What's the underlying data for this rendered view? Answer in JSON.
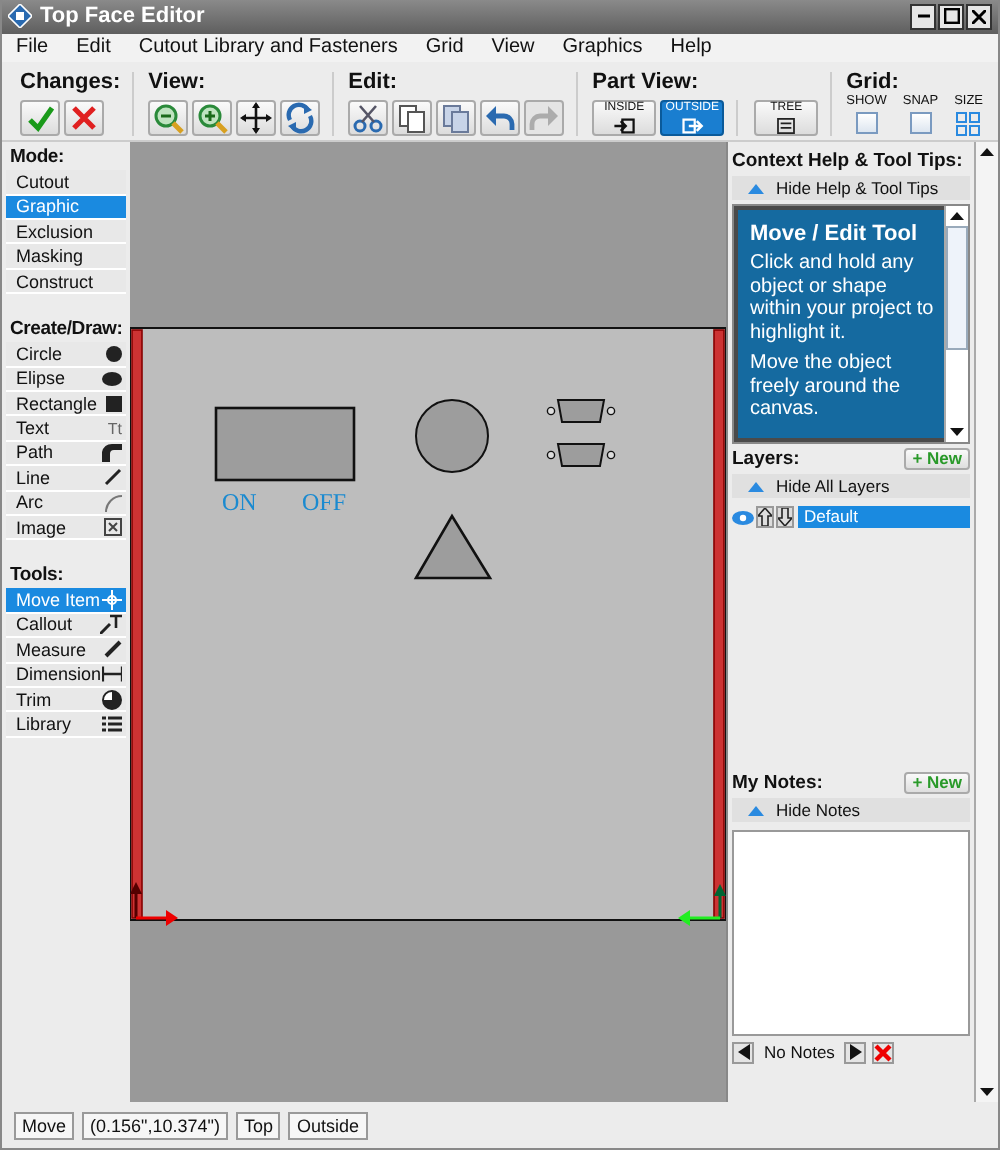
{
  "window": {
    "title": "Top Face Editor"
  },
  "menu": [
    "File",
    "Edit",
    "Cutout Library and Fasteners",
    "Grid",
    "View",
    "Graphics",
    "Help"
  ],
  "toolbar": [
    {
      "title": "Changes:",
      "buttons": [
        {
          "kind": "accept",
          "disabled": false
        },
        {
          "kind": "discard",
          "disabled": false
        }
      ]
    },
    {
      "title": "View:",
      "buttons": [
        {
          "kind": "zoom-out",
          "disabled": false
        },
        {
          "kind": "zoom-in",
          "disabled": false
        },
        {
          "kind": "pan",
          "disabled": false
        },
        {
          "kind": "refresh",
          "disabled": false
        }
      ]
    },
    {
      "title": "Edit:",
      "buttons": [
        {
          "kind": "cut",
          "disabled": false
        },
        {
          "kind": "copy",
          "disabled": false
        },
        {
          "kind": "duplicate",
          "disabled": false
        },
        {
          "kind": "undo",
          "disabled": false
        },
        {
          "kind": "redo",
          "disabled": true
        }
      ]
    }
  ],
  "part_view": {
    "title": "Part View:",
    "views": [
      {
        "label": "INSIDE",
        "kind": "inside",
        "selected": false
      },
      {
        "label": "OUTSIDE",
        "kind": "outside",
        "selected": true
      }
    ],
    "tree": {
      "label": "TREE"
    }
  },
  "grid": {
    "title": "Grid:",
    "show": {
      "label": "SHOW",
      "checked": false
    },
    "snap": {
      "label": "SNAP",
      "checked": false
    },
    "size": {
      "label": "SIZE"
    }
  },
  "sidebar": [
    {
      "title": "Mode:",
      "items": [
        {
          "label": "Cutout",
          "selected": false
        },
        {
          "label": "Graphic",
          "selected": true
        },
        {
          "label": "Exclusion",
          "selected": false
        },
        {
          "label": "Masking",
          "selected": false
        },
        {
          "label": "Construct",
          "selected": false
        }
      ]
    },
    {
      "title": "Create/Draw:",
      "items": [
        {
          "label": "Circle",
          "kind": "circle",
          "selected": false
        },
        {
          "label": "Elipse",
          "kind": "ellipse",
          "selected": false
        },
        {
          "label": "Rectangle",
          "kind": "rectangle",
          "selected": false
        },
        {
          "label": "Text",
          "kind": "text",
          "glyph": "Tt",
          "selected": false
        },
        {
          "label": "Path",
          "kind": "path",
          "selected": false
        },
        {
          "label": "Line",
          "kind": "line",
          "selected": false
        },
        {
          "label": "Arc",
          "kind": "arc",
          "selected": false
        },
        {
          "label": "Image",
          "kind": "image",
          "selected": false
        }
      ]
    },
    {
      "title": "Tools:",
      "items": [
        {
          "label": "Move Item",
          "kind": "move",
          "selected": true
        },
        {
          "label": "Callout",
          "kind": "callout",
          "selected": false
        },
        {
          "label": "Measure",
          "kind": "measure",
          "selected": false
        },
        {
          "label": "Dimension",
          "kind": "dimension",
          "selected": false
        },
        {
          "label": "Trim",
          "kind": "trim",
          "selected": false
        },
        {
          "label": "Library",
          "kind": "library",
          "selected": false
        }
      ]
    }
  ],
  "canvas": {
    "shapes": [
      {
        "kind": "rectangle"
      },
      {
        "kind": "circle"
      },
      {
        "kind": "connector"
      },
      {
        "kind": "connector"
      },
      {
        "kind": "triangle"
      }
    ],
    "labels": [
      "ON",
      "OFF"
    ]
  },
  "help": {
    "title": "Context Help & Tool Tips:",
    "toggle": "Hide Help & Tool Tips",
    "heading": "Move / Edit Tool",
    "paragraphs": [
      "Click and hold any object or shape within your project to highlight it.",
      "Move the object freely around the canvas."
    ]
  },
  "layers": {
    "title": "Layers:",
    "new_button": "+ New",
    "toggle": "Hide All Layers",
    "items": [
      {
        "name": "Default",
        "selected": true
      }
    ]
  },
  "notes": {
    "title": "My Notes:",
    "new_button": "+ New",
    "toggle": "Hide Notes",
    "status": "No Notes"
  },
  "status_bar": [
    "Move",
    "(0.156\",10.374\")",
    "Top",
    "Outside"
  ]
}
